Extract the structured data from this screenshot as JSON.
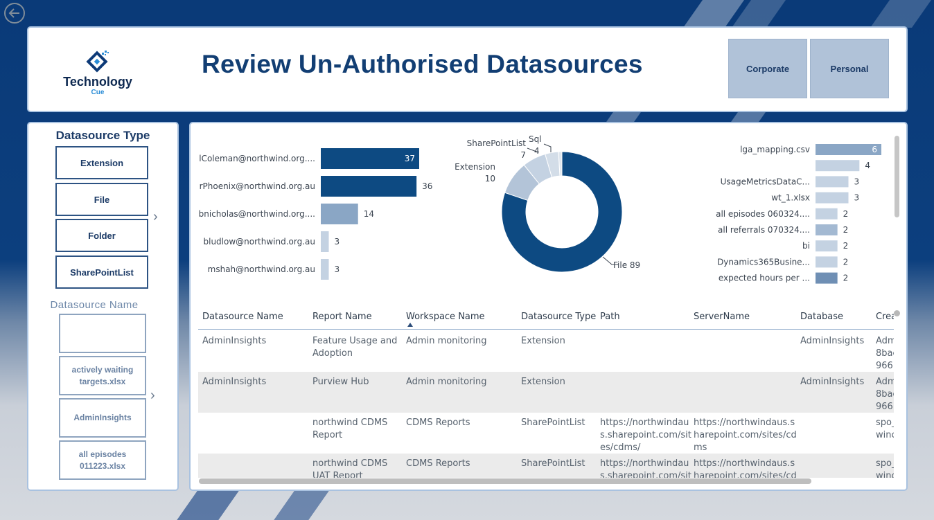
{
  "header": {
    "title": "Review Un-Authorised Datasources",
    "logo_text": "Technology",
    "logo_sub": "Cue",
    "buttons": [
      "Corporate",
      "Personal"
    ]
  },
  "left_panel": {
    "type_title": "Datasource Type",
    "types": [
      "Extension",
      "File",
      "Folder",
      "SharePointList"
    ],
    "name_title": "Datasource Name",
    "names": [
      "",
      "actively waiting targets.xlsx",
      "AdminInsights",
      "all episodes 011223.xlsx"
    ]
  },
  "colors": {
    "dark_blue": "#0d4a82",
    "mid_blue": "#8aa6c5",
    "light_blue": "#c4d2e2",
    "panel_border": "#a9c2e0"
  },
  "chart_data": [
    {
      "type": "bar",
      "orientation": "horizontal",
      "categories": [
        "lColeman@northwind.org....",
        "rPhoenix@northwind.org.au",
        "bnicholas@northwind.org....",
        "bludlow@northwind.org.au",
        "mshah@northwind.org.au"
      ],
      "values": [
        37,
        36,
        14,
        3,
        3
      ]
    },
    {
      "type": "pie",
      "subtype": "donut",
      "categories": [
        "File",
        "Extension",
        "SharePointList",
        "Sql",
        ""
      ],
      "values": [
        89,
        10,
        7,
        4,
        1
      ],
      "labels": [
        "File 89",
        "Extension",
        "SharePointList",
        "Sql",
        ""
      ],
      "value_labels": [
        "89",
        "10",
        "7",
        "4",
        ""
      ]
    },
    {
      "type": "bar",
      "orientation": "horizontal",
      "categories": [
        "lga_mapping.csv",
        "",
        "UsageMetricsDataC...",
        "wt_1.xlsx",
        "all episodes 060324....",
        "all referrals 070324....",
        "bi",
        "Dynamics365Busine...",
        "expected hours per ..."
      ],
      "values": [
        6,
        4,
        3,
        3,
        2,
        2,
        2,
        2,
        2
      ]
    }
  ],
  "table": {
    "columns": [
      "Datasource Name",
      "Report Name",
      "Workspace Name",
      "Datasource Type",
      "Path",
      "ServerName",
      "Database",
      "Crea"
    ],
    "rows": [
      [
        "AdminInsights",
        "Feature Usage and|Adoption",
        "Admin monitoring",
        "Extension",
        "",
        "",
        "AdminInsights",
        "Adm|8bac|966b"
      ],
      [
        "AdminInsights",
        "Purview Hub",
        "Admin monitoring",
        "Extension",
        "",
        "",
        "AdminInsights",
        "Adm|8bac|966b"
      ],
      [
        "",
        "northwind CDMS|Report",
        "CDMS Reports",
        "SharePointList",
        "https://northwindau|s.sharepoint.com/sit|es/cdms/",
        "https://northwindaus.s|harepoint.com/sites/cd|ms",
        "",
        "spo_|winc"
      ],
      [
        "",
        "northwind CDMS|UAT Report",
        "CDMS Reports",
        "SharePointList",
        "https://northwindau|s.sharepoint.com/sit",
        "https://northwindaus.s|harepoint.com/sites/cd",
        "",
        "spo_|winc"
      ]
    ]
  }
}
